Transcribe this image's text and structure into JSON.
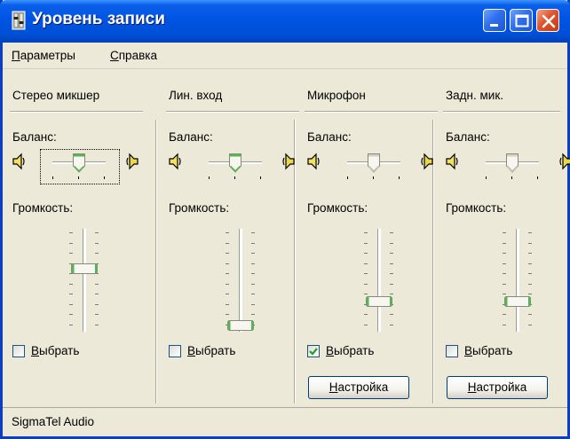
{
  "window": {
    "title": "Уровень записи",
    "buttons": {
      "minimize_icon": "minimize-icon",
      "maximize_icon": "maximize-icon",
      "close_icon": "close-icon"
    }
  },
  "menu": {
    "items": [
      {
        "first": "П",
        "rest": "араметры"
      },
      {
        "first": "С",
        "rest": "правка"
      }
    ]
  },
  "channels": [
    {
      "title": "Стерео микшер",
      "balance_label": "Баланс:",
      "balance": 0.5,
      "volume_label": "Громкость:",
      "volume": 0.6,
      "select_first": "В",
      "select_rest": "ыбрать",
      "selected": false,
      "has_settings": false,
      "focused": true
    },
    {
      "title": "Лин. вход",
      "balance_label": "Баланс:",
      "balance": 0.5,
      "volume_label": "Громкость:",
      "volume": 0.03,
      "select_first": "В",
      "select_rest": "ыбрать",
      "selected": false,
      "has_settings": false,
      "focused": false
    },
    {
      "title": "Микрофон",
      "balance_label": "Баланс:",
      "balance": 0.5,
      "volume_label": "Громкость:",
      "volume": 0.27,
      "select_first": "В",
      "select_rest": "ыбрать",
      "selected": true,
      "has_settings": true,
      "settings_first": "Н",
      "settings_rest": "астройка",
      "focused": false
    },
    {
      "title": "Задн. мик.",
      "balance_label": "Баланс:",
      "balance": 0.5,
      "volume_label": "Громкость:",
      "volume": 0.27,
      "select_first": "В",
      "select_rest": "ыбрать",
      "selected": false,
      "has_settings": true,
      "settings_first": "Н",
      "settings_rest": "астройка",
      "focused": false
    }
  ],
  "status": {
    "device": "SigmaTel Audio"
  },
  "colors": {
    "thumb_accent": "#4fb84f",
    "titlebar": "#0054e3",
    "face": "#ece9d8"
  }
}
